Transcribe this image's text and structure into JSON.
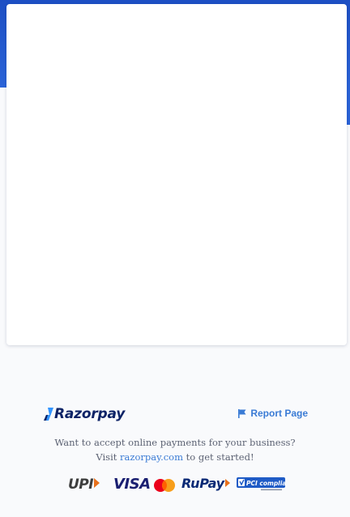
{
  "footer": {
    "brand": "Razorpay",
    "report_label": "Report Page",
    "promo_line1": "Want to accept online payments for your business?",
    "promo_visit": "Visit",
    "promo_link": "razorpay.com",
    "promo_end": "to get started!"
  },
  "payment_methods": {
    "upi": "UPI",
    "visa": "VISA",
    "mastercard": "mastercard-icon",
    "rupay": "RuPay",
    "pci": "PCI compliant"
  },
  "colors": {
    "header_blue": "#1d4fc4",
    "link_blue": "#3a7bd5",
    "brand_navy": "#0d2366"
  }
}
